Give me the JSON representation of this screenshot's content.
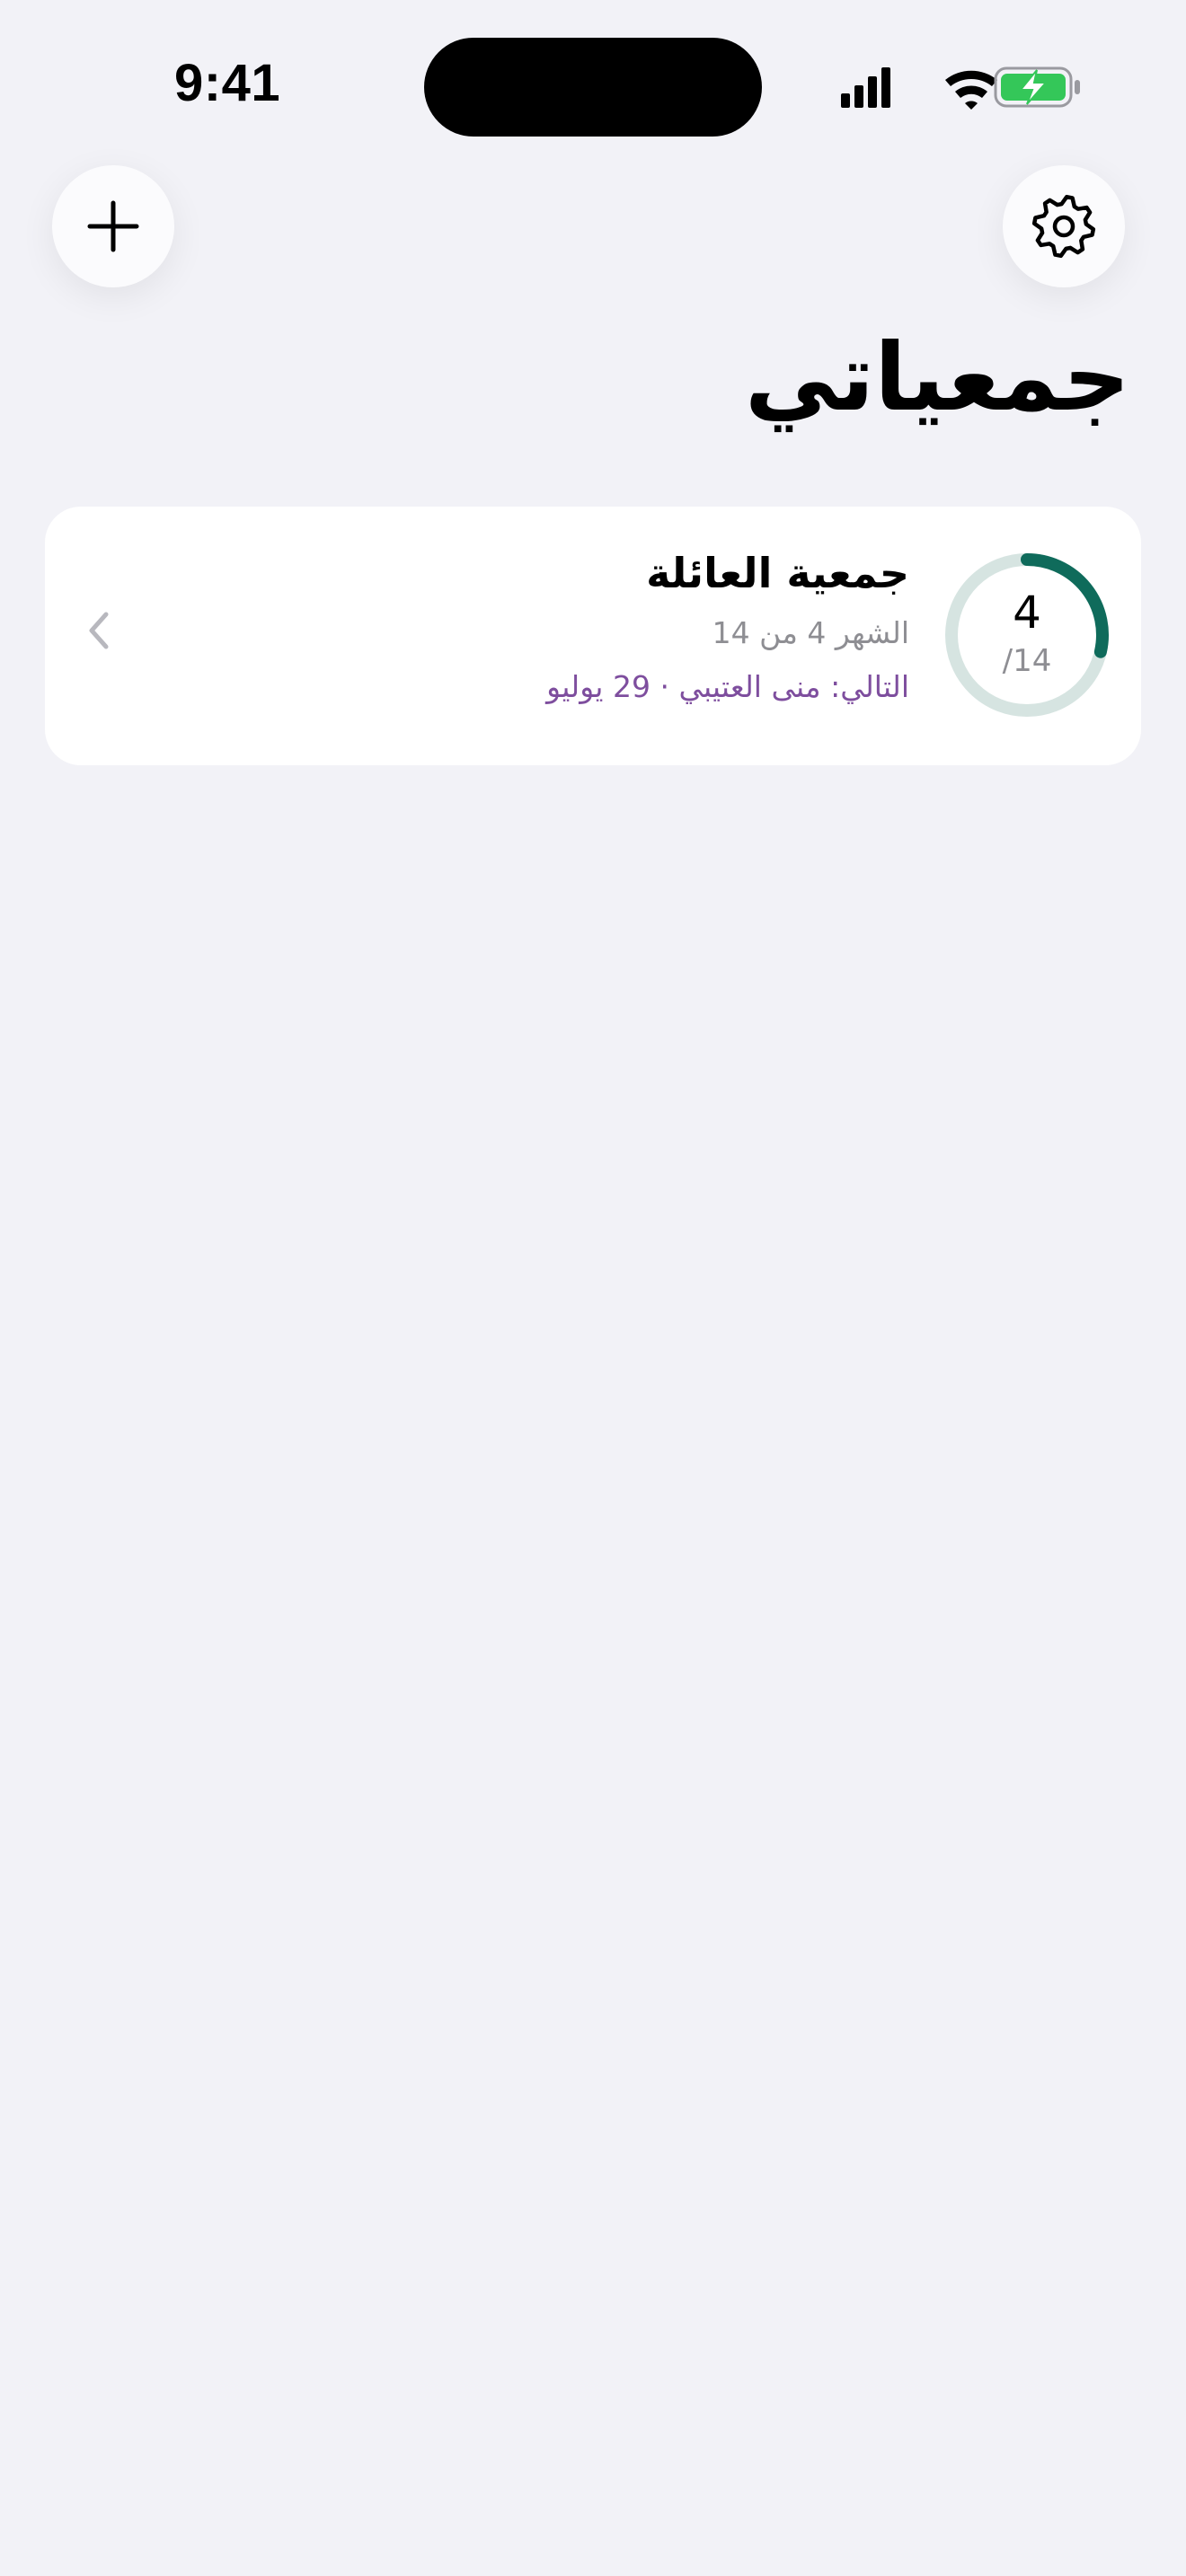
{
  "status_bar": {
    "time": "9:41",
    "icons": [
      "cellular-signal-icon",
      "wifi-icon",
      "battery-charging-icon"
    ],
    "battery_color": "#34C759"
  },
  "toolbar": {
    "add_icon": "plus-icon",
    "settings_icon": "gear-icon"
  },
  "page": {
    "title": "جمعياتي"
  },
  "groups": [
    {
      "name": "جمعية العائلة",
      "progress_text": "الشهر 4 من 14",
      "next_text": "التالي: منى العتيبي · 29 يوليو",
      "current_month": "4",
      "total_label": "/14",
      "progress_fraction": 0.2857,
      "ring_color": "#0F6B5B",
      "ring_track_color": "#D6E4E1",
      "next_color": "#7E4E9E",
      "chevron_icon": "chevron-left-icon"
    }
  ]
}
